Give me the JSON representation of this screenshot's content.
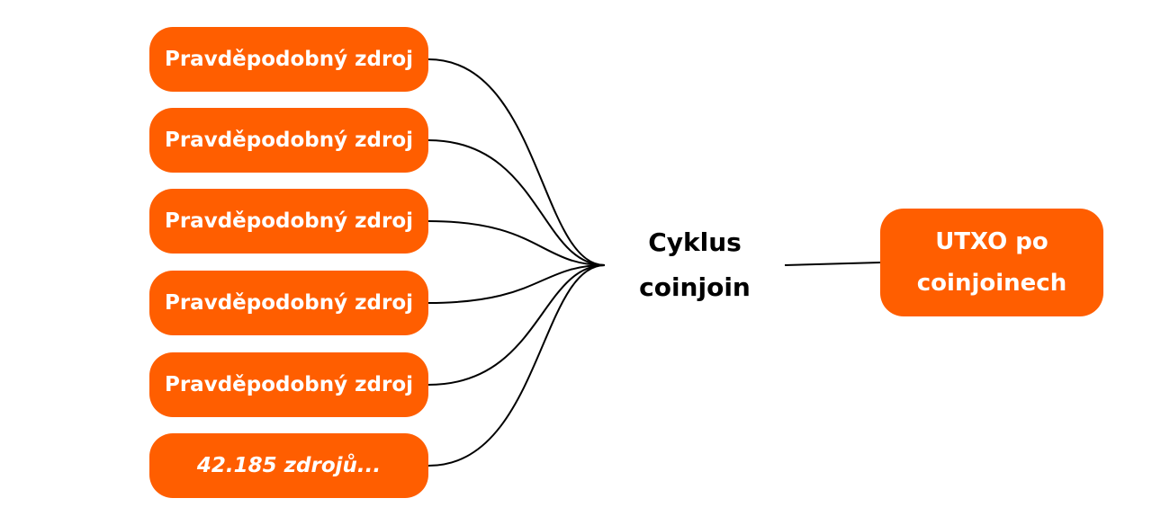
{
  "sources": [
    {
      "label": "Pravděpodobný zdroj"
    },
    {
      "label": "Pravděpodobný zdroj"
    },
    {
      "label": "Pravděpodobný zdroj"
    },
    {
      "label": "Pravděpodobný zdroj"
    },
    {
      "label": "Pravděpodobný zdroj"
    },
    {
      "label": "42.185 zdrojů..."
    }
  ],
  "cycle": {
    "line1": "Cyklus",
    "line2": "coinjoin"
  },
  "result": {
    "line1": "UTXO po",
    "line2": "coinjoinech"
  },
  "colors": {
    "accent": "#ff5e00",
    "connector": "#000000",
    "text_on_accent": "#ffffff",
    "text_dark": "#000000"
  }
}
